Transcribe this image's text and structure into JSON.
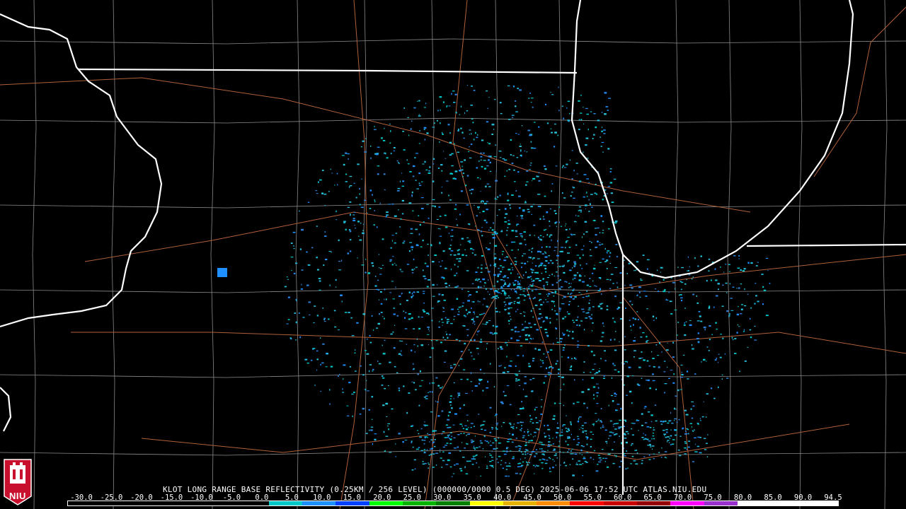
{
  "header": {
    "title": "KLOT LONG RANGE BASE REFLECTIVITY (0.25KM / 256 LEVEL) (000000/0000 0.5 DEG) 2025-06-06 17:52 UTC  ATLAS.NIU.EDU"
  },
  "logo": {
    "text": "NIU",
    "icon": "university-tower-icon",
    "color": "#c8102e"
  },
  "colors": {
    "state_border": "#ffffff",
    "county_border": "#8a8a8a",
    "highway": "#b0603a",
    "background": "#000000"
  },
  "scale": {
    "labels": [
      "-30.0",
      "-25.0",
      "-20.0",
      "-15.0",
      "-10.0",
      "-5.0",
      "0.0",
      "5.0",
      "10.0",
      "15.0",
      "20.0",
      "25.0",
      "30.0",
      "35.0",
      "40.0",
      "45.0",
      "50.0",
      "55.0",
      "60.0",
      "65.0",
      "70.0",
      "75.0",
      "80.0",
      "85.0",
      "90.0",
      "94.5"
    ],
    "colors": [
      "#000000",
      "#000000",
      "#000000",
      "#000000",
      "#000000",
      "#000000",
      "#00c8c8",
      "#1e90ff",
      "#0040ff",
      "#00ff00",
      "#00b400",
      "#008000",
      "#ffff00",
      "#e6b400",
      "#ff8c00",
      "#ff0000",
      "#c80000",
      "#960000",
      "#ff00ff",
      "#9932cc",
      "#ffffff",
      "#ffffff",
      "#ffffff"
    ]
  }
}
